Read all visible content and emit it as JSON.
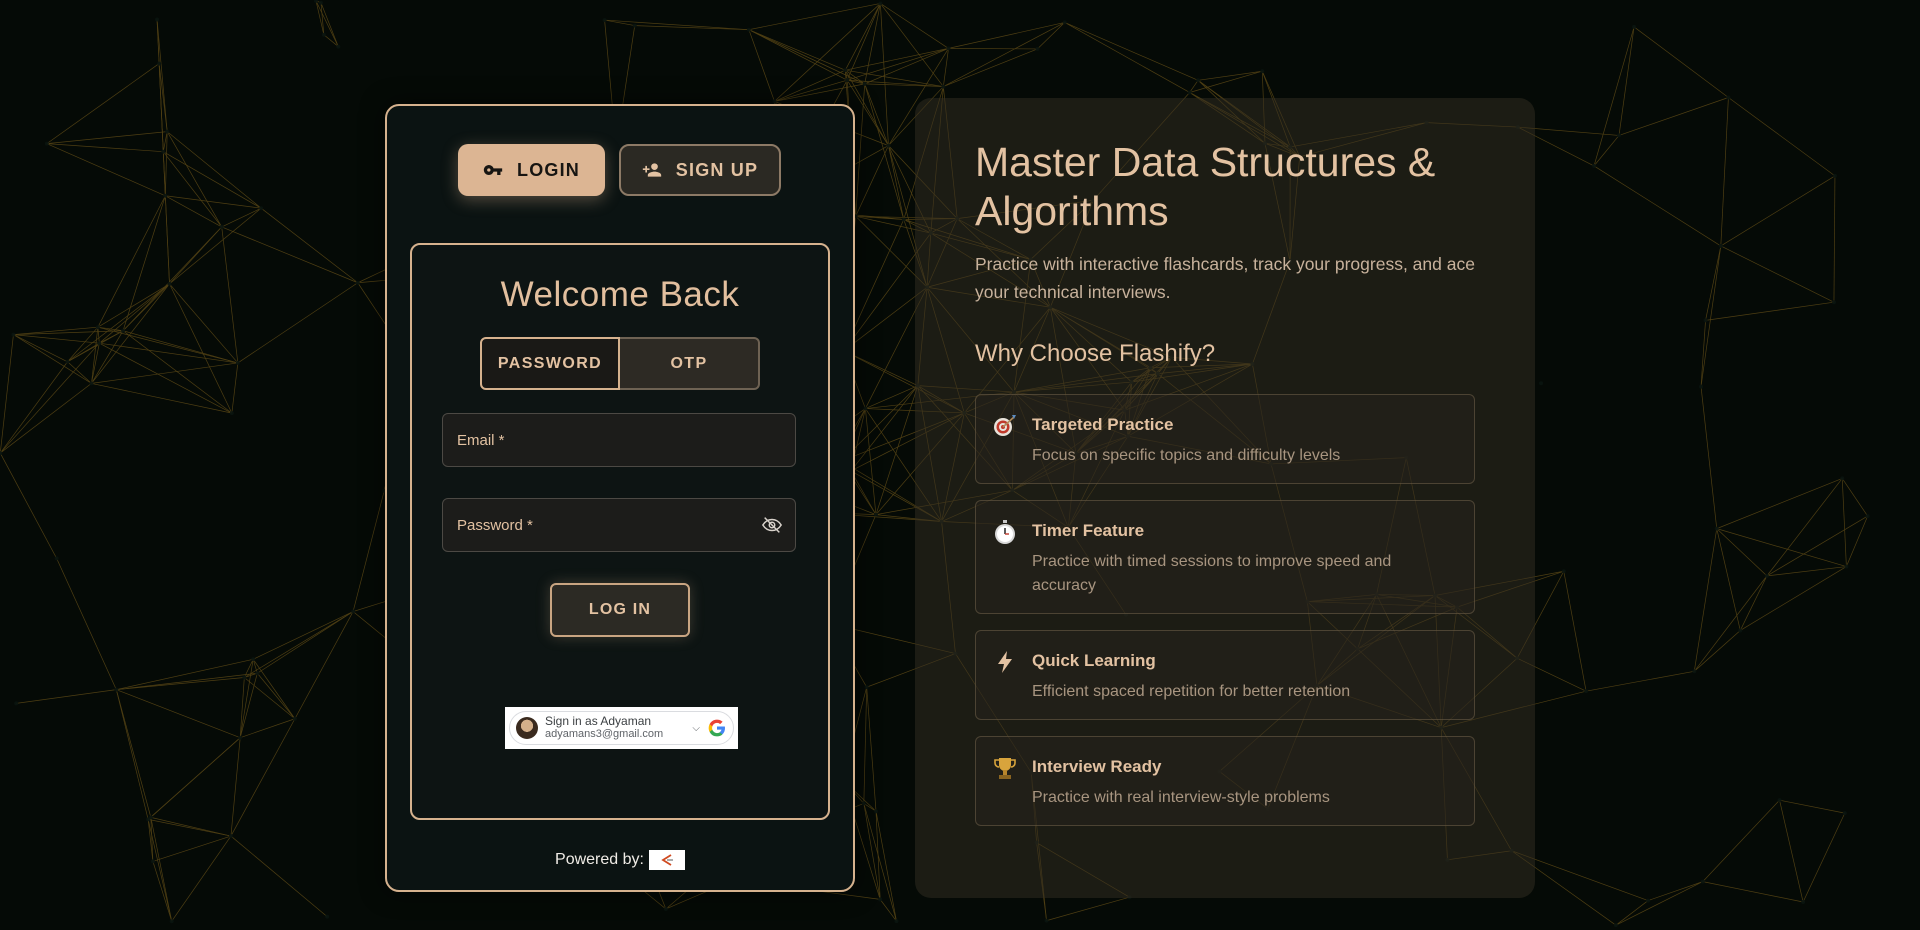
{
  "auth": {
    "tabs": {
      "login_label": "LOGIN",
      "signup_label": "SIGN UP"
    },
    "welcome_title": "Welcome Back",
    "mode": {
      "password_label": "PASSWORD",
      "otp_label": "OTP"
    },
    "fields": {
      "email_label": "Email *",
      "password_label": "Password *"
    },
    "login_button": "LOG IN",
    "google_signin": {
      "name_text": "Sign in as Adyaman",
      "email_text": "adyamans3@gmail.com"
    },
    "powered_by": "Powered by:"
  },
  "info": {
    "title": "Master Data Structures & Algorithms",
    "subtitle": "Practice with interactive flashcards, track your progress, and ace your technical interviews.",
    "why_title": "Why Choose Flashify?",
    "features": [
      {
        "icon": "target-icon",
        "title": "Targeted Practice",
        "desc": "Focus on specific topics and difficulty levels"
      },
      {
        "icon": "stopwatch-icon",
        "title": "Timer Feature",
        "desc": "Practice with timed sessions to improve speed and accuracy"
      },
      {
        "icon": "lightning-icon",
        "title": "Quick Learning",
        "desc": "Efficient spaced repetition for better retention"
      },
      {
        "icon": "trophy-icon",
        "title": "Interview Ready",
        "desc": "Practice with real interview-style problems"
      }
    ]
  },
  "colors": {
    "accent": "#dcb593",
    "background": "#050a06",
    "card": "#0b1312",
    "network_lines": "#8a6a1e"
  }
}
